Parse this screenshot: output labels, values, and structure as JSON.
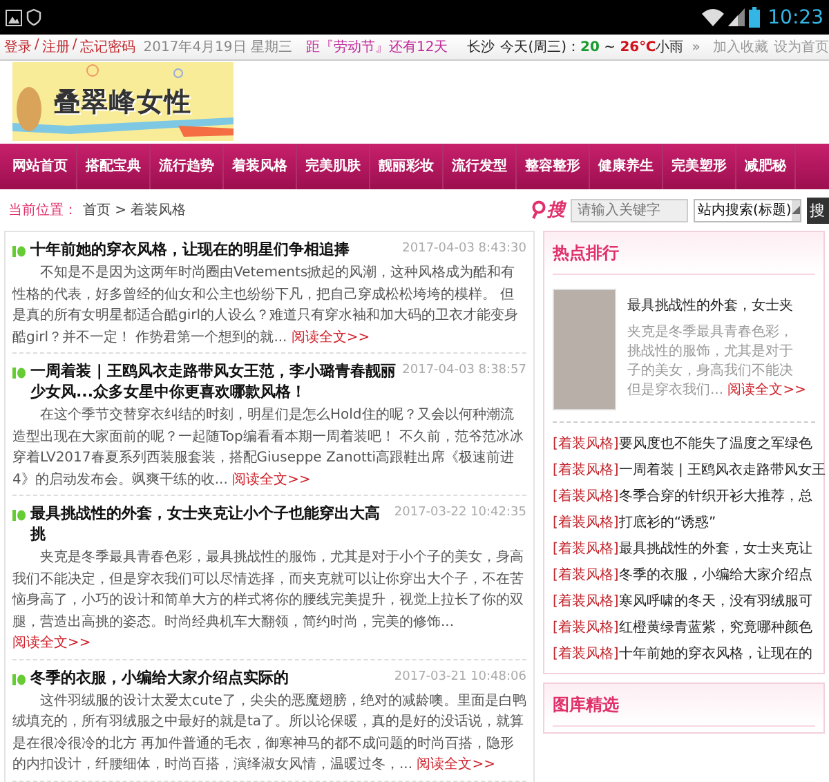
{
  "status_bar": {
    "time": "10:23"
  },
  "top_bar": {
    "account_links": [
      "登录",
      "注册",
      "忘记密码"
    ],
    "link_separator": "/",
    "date": "2017年4月19日 星期三",
    "countdown": "距『劳动节』还有12天",
    "weather": {
      "city": "长沙",
      "day": "今天(周三)：",
      "low": "20",
      "separator": "~",
      "high": "26℃",
      "condition": "小雨",
      "more": "»"
    },
    "right_links": [
      "加入收藏",
      "设为首页"
    ]
  },
  "logo": {
    "text": "叠翠峰女性"
  },
  "nav": [
    "网站首页",
    "搭配宝典",
    "流行趋势",
    "着装风格",
    "完美肌肤",
    "靓丽彩妆",
    "流行发型",
    "整容整形",
    "健康养生",
    "完美塑形",
    "减肥秘"
  ],
  "breadcrumb": {
    "label": "当前位置：",
    "path": "首页 > 着装风格"
  },
  "search": {
    "logo_text": "搜",
    "placeholder": "请输入关键字",
    "scope": "站内搜索(标题)",
    "button": "搜"
  },
  "articles": [
    {
      "title": "十年前她的穿衣风格，让现在的明星们争相追捧",
      "date": "2017-04-03 8:43:30",
      "excerpt": "不知是不是因为这两年时尚圈由Vetements掀起的风潮，这种风格成为酷和有性格的代表，好多曾经的仙女和公主也纷纷下凡，把自己穿成松松垮垮的模样。    但是真的所有女明星都适合酷girl的人设么？难道只有穿水袖和加大码的卫衣才能变身酷girl？并不一定！    作势君第一个想到的就...",
      "more": "阅读全文>>"
    },
    {
      "title": "一周着装 | 王鸥风衣走路带风女王范，李小璐青春靓丽少女风...众多女星中你更喜欢哪款风格！",
      "date": "2017-04-03 8:38:57",
      "excerpt": "在这个季节交替穿衣纠结的时刻，明星们是怎么Hold住的呢？又会以何种潮流造型出现在大家面前的呢？一起随Top编看看本期一周着装吧！    不久前，范爷范冰冰穿着LV2017春夏系列西装服套装，搭配Giuseppe Zanotti高跟鞋出席《极速前进4》的启动发布会。飒爽干练的收...",
      "more": "阅读全文>>"
    },
    {
      "title": "最具挑战性的外套，女士夹克让小个子也能穿出大高挑",
      "date": "2017-03-22 10:42:35",
      "excerpt": "夹克是冬季最具青春色彩，最具挑战性的服饰，尤其是对于小个子的美女，身高我们不能决定，但是穿衣我们可以尽情选择，而夹克就可以让你穿出大个子，不在苦恼身高了，小巧的设计和简单大方的样式将你的腰线完美提升，视觉上拉长了你的双腿，营造出高挑的姿态。时尚经典机车大翻领，简约时尚，完美的修饰...",
      "more": "阅读全文>>"
    },
    {
      "title": "冬季的衣服，小编给大家介绍点实际的",
      "date": "2017-03-21 10:48:06",
      "excerpt": "这件羽绒服的设计太爱太cute了，尖尖的恶魔翅膀，绝对的减龄噢。里面是白鸭绒填充的，所有羽绒服之中最好的就是ta了。所以论保暖，真的是好的没话说，就算是在很冷很冷的北方 再加件普通的毛衣，御寒神马的都不成问题的时尚百搭，隐形的内扣设计，纤腰细体，时尚百搭，演绎淑女风情，温暖过冬，...",
      "more": "阅读全文>>"
    }
  ],
  "hot_ranking": {
    "title": "热点排行",
    "featured": {
      "title": "最具挑战性的外套，女士夹",
      "excerpt_lines": [
        "夹克是冬季最具青春色彩，",
        "挑战性的服饰，尤其是对于",
        "子的美女，身高我们不能决",
        "但是穿衣我们..."
      ],
      "more": "阅读全文>>"
    },
    "items": [
      {
        "tag": "[着装风格]",
        "title": "要风度也不能失了温度之军绿色"
      },
      {
        "tag": "[着装风格]",
        "title": "一周着装 | 王鸥风衣走路带风女王"
      },
      {
        "tag": "[着装风格]",
        "title": "冬季合穿的针织开衫大推荐，总"
      },
      {
        "tag": "[着装风格]",
        "title": "打底衫的“诱惑”"
      },
      {
        "tag": "[着装风格]",
        "title": "最具挑战性的外套，女士夹克让"
      },
      {
        "tag": "[着装风格]",
        "title": "冬季的衣服，小编给大家介绍点"
      },
      {
        "tag": "[着装风格]",
        "title": "寒风呼啸的冬天，没有羽绒服可"
      },
      {
        "tag": "[着装风格]",
        "title": "红橙黄绿青蓝紫，究竟哪种颜色"
      },
      {
        "tag": "[着装风格]",
        "title": "十年前她的穿衣风格，让现在的"
      }
    ]
  },
  "gallery": {
    "title": "图库精选"
  }
}
